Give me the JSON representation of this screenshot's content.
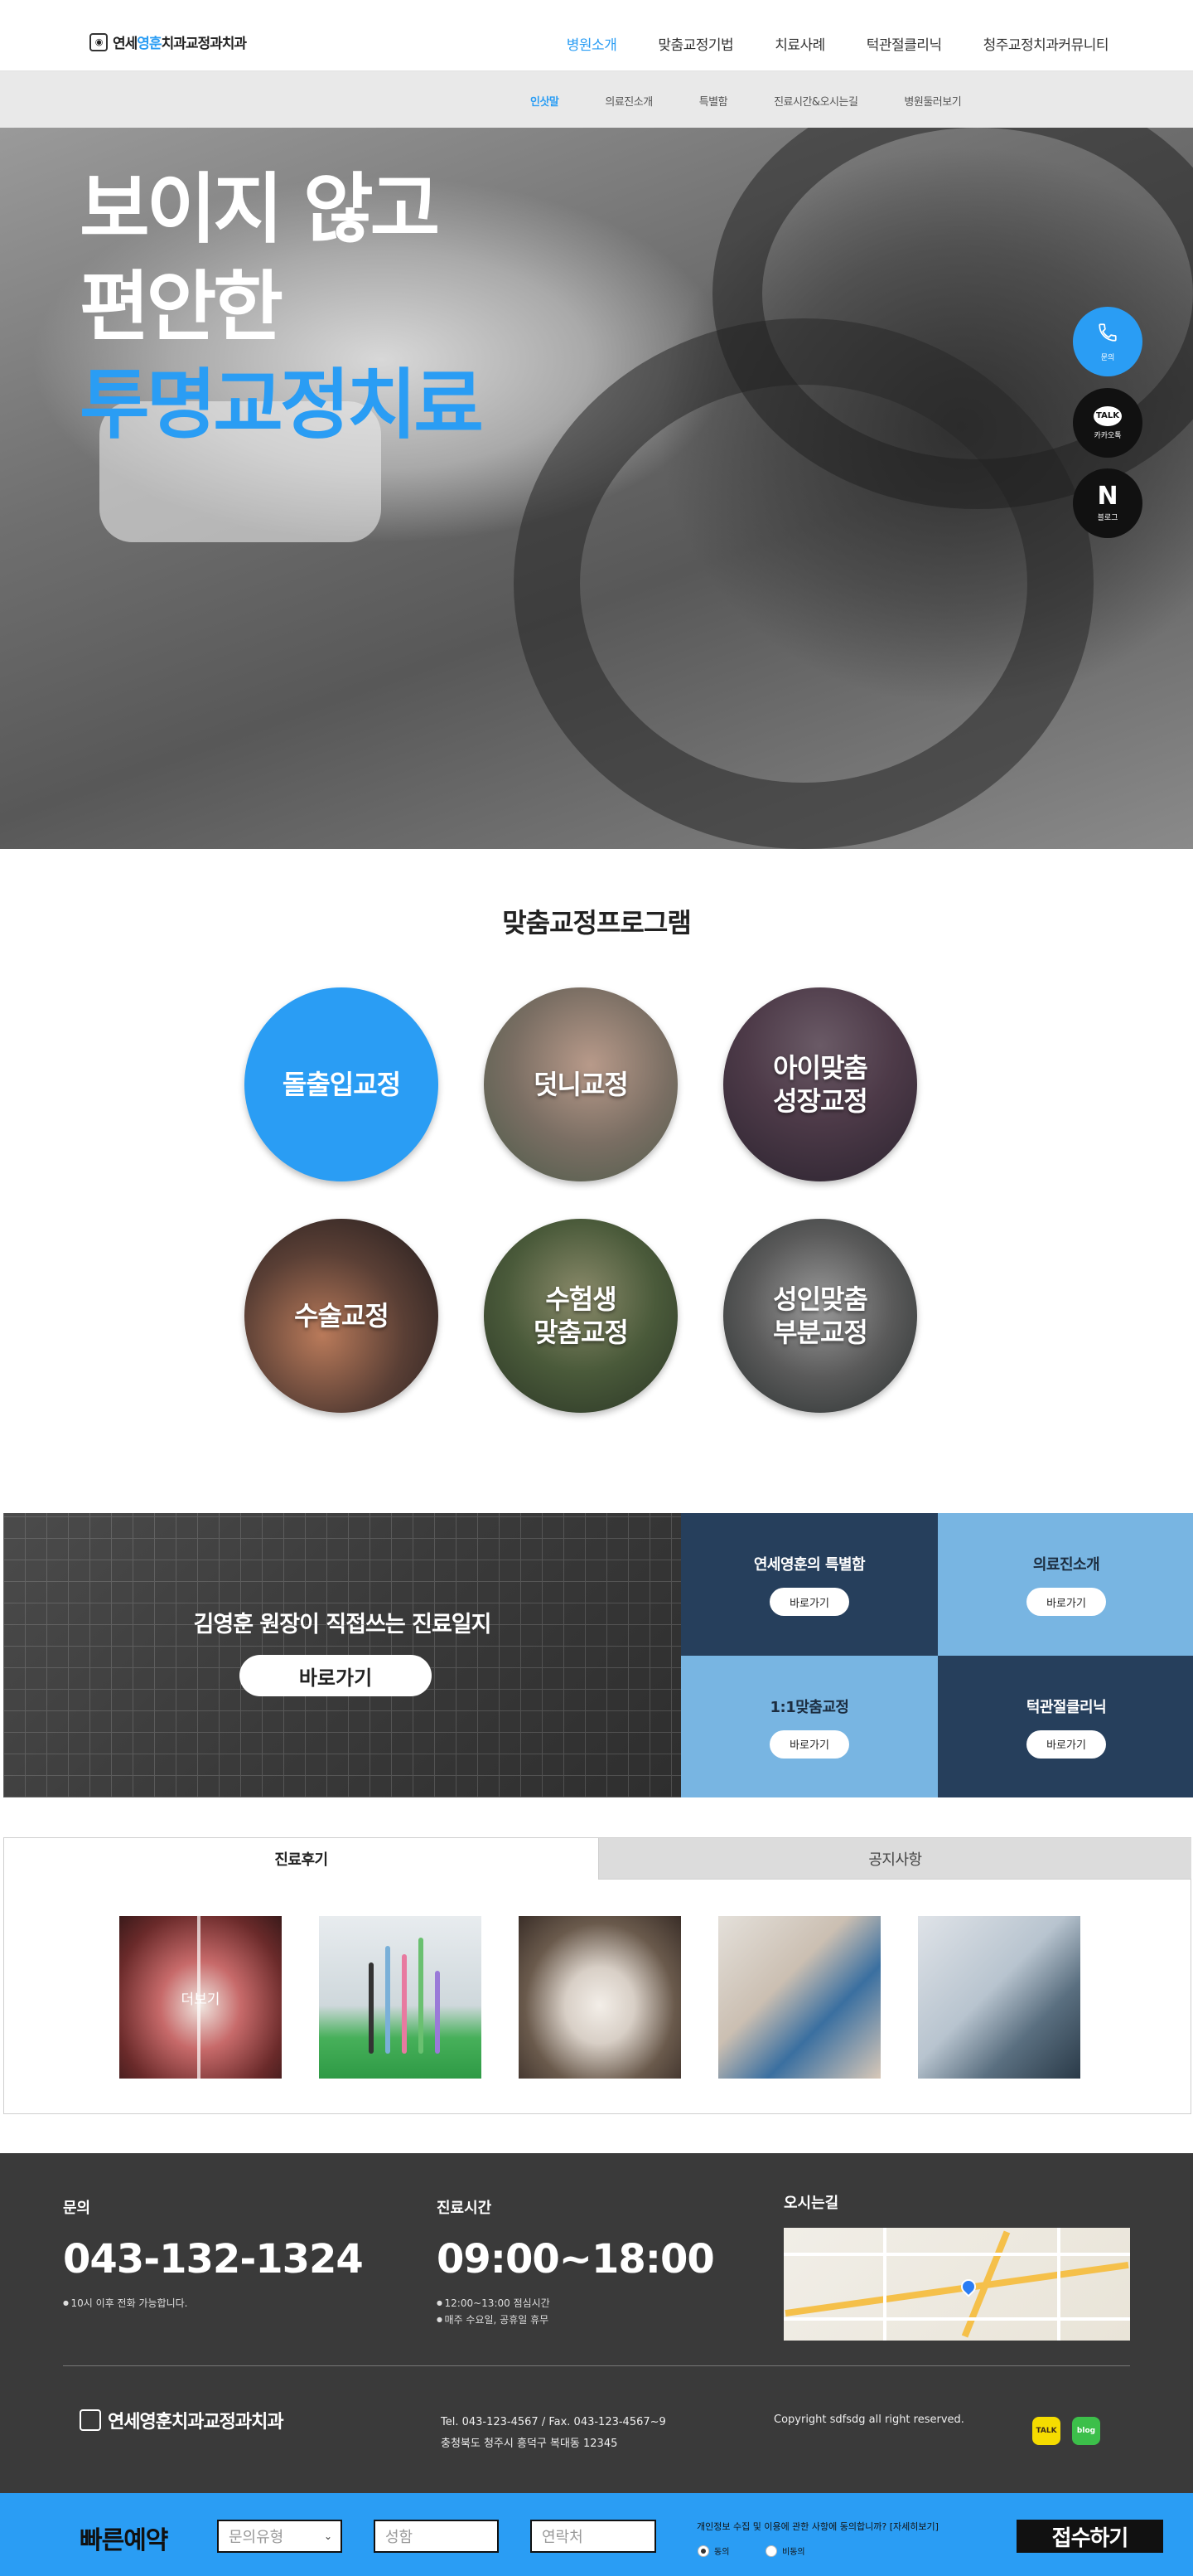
{
  "header": {
    "logo_prefix": "연세",
    "logo_accent": "영훈",
    "logo_suffix": "치과교정과치과",
    "nav": [
      "병원소개",
      "맞춤교정기법",
      "치료사례",
      "턱관절클리닉",
      "청주교정치과커뮤니티"
    ],
    "active_nav": "병원소개"
  },
  "subnav": {
    "items": [
      "인삿말",
      "의료진소개",
      "특별함",
      "진료시간&오시는길",
      "병원둘러보기"
    ],
    "active": "인삿말"
  },
  "hero": {
    "line1": "보이지 않고",
    "line2": "편안한",
    "line3": "투명교정치료",
    "accent_color": "#2a9df4"
  },
  "quick_menu": {
    "call_icon": "phone-icon",
    "call_label": "문의",
    "kakao_badge": "TALK",
    "kakao_label": "카카오톡",
    "blog_icon": "N",
    "blog_label": "블로그"
  },
  "programs": {
    "title": "맞춤교정프로그램",
    "items": [
      "돌출입교정",
      "덧니교정",
      "아이맞춤\n성장교정",
      "수술교정",
      "수험생\n맞춤교정",
      "성인맞춤\n부분교정"
    ]
  },
  "promo": {
    "title": "김영훈 원장이 직접쓰는 진료일지",
    "button": "바로가기",
    "tiles": [
      {
        "title": "연세영훈의 특별함",
        "button": "바로가기"
      },
      {
        "title": "의료진소개",
        "button": "바로가기"
      },
      {
        "title": "1:1맞춤교정",
        "button": "바로가기"
      },
      {
        "title": "턱관절클리닉",
        "button": "바로가기"
      }
    ]
  },
  "board": {
    "tabs": [
      "진료후기",
      "공지사항"
    ],
    "active_tab": "진료후기",
    "more_label": "더보기"
  },
  "footer": {
    "inquiry_label": "문의",
    "phone": "043-132-1324",
    "phone_note": "10시 이후 전화 가능합니다.",
    "hours_label": "진료시간",
    "hours": "09:00~18:00",
    "hours_note1": "12:00~13:00 점심시간",
    "hours_note2": "매주 수요일, 공휴일 휴무",
    "location_label": "오시는길",
    "logo_text": "연세영훈치과교정과치과",
    "tel_fax": "Tel. 043-123-4567 / Fax. 043-123-4567~9",
    "address": "충청북도 청주시 흥덕구 복대동 12345",
    "copyright": "Copyright sdfsdg all right reserved.",
    "sns_kakao": "TALK",
    "sns_blog": "blog"
  },
  "reservation": {
    "title": "빠른예약",
    "type_placeholder": "문의유형",
    "name_placeholder": "성함",
    "contact_placeholder": "연락처",
    "consent_text": "개인정보 수집 및 이용에 관한 사항에 동의합니까? [자세히보기]",
    "agree_label": "동의",
    "disagree_label": "비동의",
    "agree_selected": true,
    "submit_label": "접수하기"
  },
  "colors": {
    "brand_blue": "#2a9df4",
    "navy": "#263f5c",
    "light_blue": "#78b5e2",
    "footer_bg": "#3a3a3a"
  }
}
